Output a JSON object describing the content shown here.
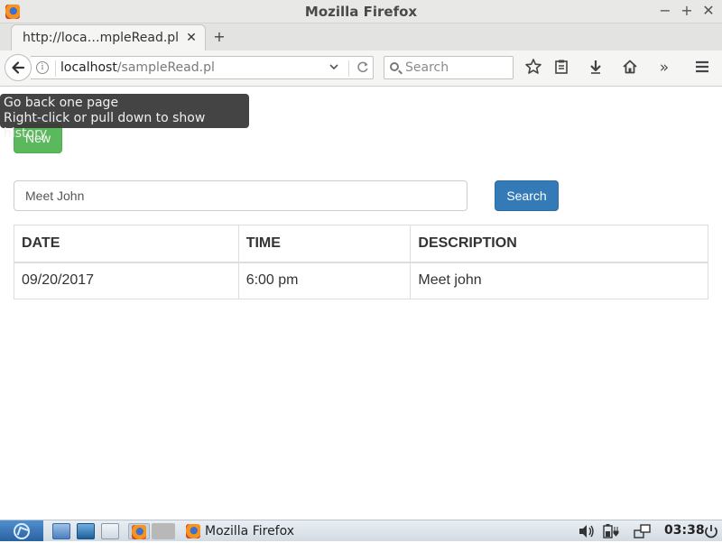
{
  "window": {
    "title": "Mozilla Firefox",
    "controls": {
      "minimize": "−",
      "maximize": "+",
      "close": "✕"
    }
  },
  "tabs": [
    {
      "label": "http://loca…mpleRead.pl",
      "close": "✕"
    }
  ],
  "new_tab_label": "+",
  "navbar": {
    "url_host": "localhost",
    "url_path": "/sampleRead.pl",
    "search_placeholder": "Search",
    "overflow_label": "»"
  },
  "tooltip": {
    "line1": "Go back one page",
    "line2": "Right-click or pull down to show history"
  },
  "page": {
    "new_button": "New",
    "search_value": "Meet John",
    "search_button": "Search",
    "table": {
      "headers": [
        "DATE",
        "TIME",
        "DESCRIPTION"
      ],
      "rows": [
        [
          "09/20/2017",
          "6:00 pm",
          "Meet john"
        ]
      ]
    }
  },
  "taskbar": {
    "window_label": "Mozilla Firefox",
    "clock": "03:38"
  },
  "colors": {
    "success": "#5cb85c",
    "primary": "#337ab7"
  },
  "icons": {
    "back": "back-arrow-icon",
    "info": "info-icon",
    "reload": "reload-icon",
    "bookmark": "star-icon",
    "reading_list": "clipboard-icon",
    "downloads": "download-arrow-icon",
    "home": "home-icon",
    "menu": "hamburger-icon"
  }
}
